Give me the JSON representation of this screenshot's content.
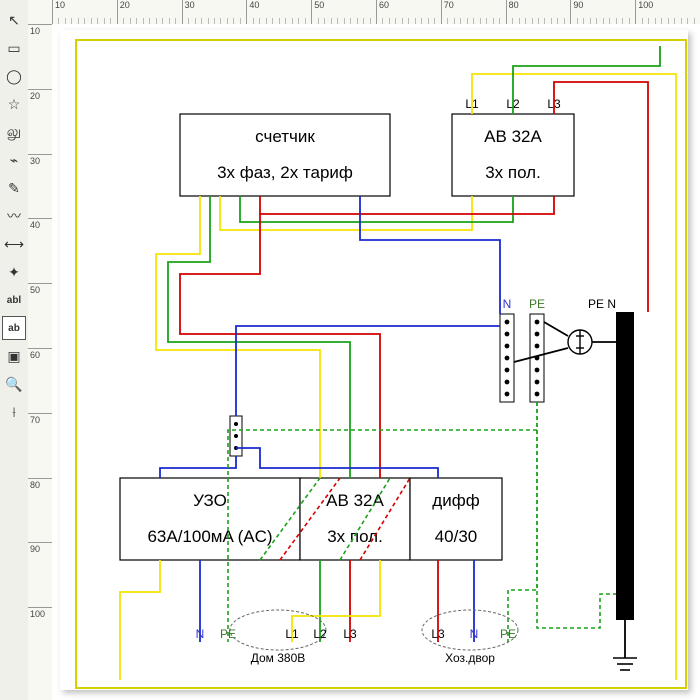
{
  "ruler": {
    "major": [
      10,
      20,
      30,
      40,
      50,
      60,
      70,
      80,
      90,
      100
    ]
  },
  "toolbar": {
    "items": [
      {
        "name": "pointer-icon",
        "glyph": "↖"
      },
      {
        "name": "rect-icon",
        "glyph": "▭"
      },
      {
        "name": "ellipse-icon",
        "glyph": "◯"
      },
      {
        "name": "star-icon",
        "glyph": "☆"
      },
      {
        "name": "spiral-icon",
        "glyph": "லு"
      },
      {
        "name": "polyline-icon",
        "glyph": "⌁"
      },
      {
        "name": "bezier-icon",
        "glyph": "✎"
      },
      {
        "name": "freehand-icon",
        "glyph": "〰"
      },
      {
        "name": "measure-icon",
        "glyph": "⟷"
      },
      {
        "name": "mirror-icon",
        "glyph": "✦"
      },
      {
        "name": "text-icon",
        "glyph": "abl"
      },
      {
        "name": "textbox-icon",
        "glyph": "ab",
        "selected": true
      },
      {
        "name": "image-icon",
        "glyph": "▣"
      },
      {
        "name": "zoom-icon",
        "glyph": "🔍"
      },
      {
        "name": "ruler-icon",
        "glyph": "⟊"
      }
    ]
  },
  "blocks": {
    "meter": {
      "line1": "счетчик",
      "line2": "3х фаз, 2х тариф"
    },
    "breaker": {
      "line1": "АВ 32А",
      "line2": "3х пол."
    },
    "uzo": {
      "line1": "УЗО",
      "line2": "63A/100мA (AC)"
    },
    "brk2": {
      "line1": "АВ 32А",
      "line2": "3х пол."
    },
    "diff": {
      "line1": "дифф",
      "line2": "40/30"
    }
  },
  "labels": {
    "L1": "L1",
    "L2": "L2",
    "L3": "L3",
    "N": "N",
    "PE": "PE",
    "PEN": "PE N",
    "out_house": "Дом 380В",
    "out_yard": "Хоз.двор"
  }
}
